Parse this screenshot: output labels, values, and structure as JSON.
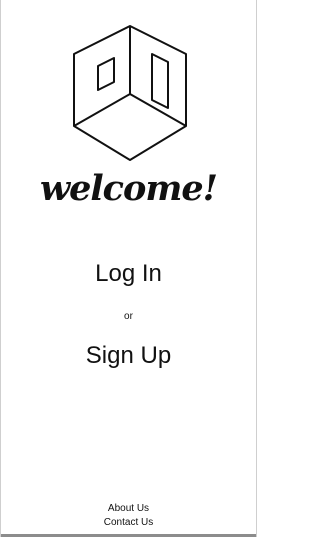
{
  "welcome": {
    "heading": "welcome!"
  },
  "auth": {
    "login_label": "Log In",
    "separator": "or",
    "signup_label": "Sign Up"
  },
  "footer": {
    "about_label": "About Us",
    "contact_label": "Contact Us"
  },
  "logo": {
    "icon": "cube-room-icon"
  }
}
